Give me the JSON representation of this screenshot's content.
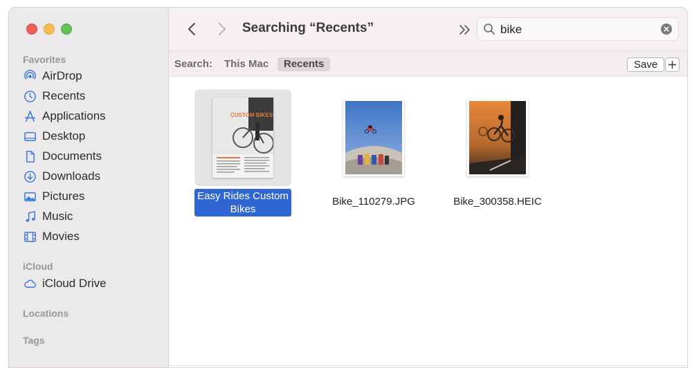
{
  "window": {
    "title": "Searching “Recents”"
  },
  "sidebar": {
    "sections": {
      "favorites": "Favorites",
      "icloud": "iCloud",
      "locations": "Locations",
      "tags": "Tags"
    },
    "favorites": [
      {
        "label": "AirDrop",
        "icon": "airdrop-icon"
      },
      {
        "label": "Recents",
        "icon": "clock-icon"
      },
      {
        "label": "Applications",
        "icon": "applications-icon"
      },
      {
        "label": "Desktop",
        "icon": "desktop-icon"
      },
      {
        "label": "Documents",
        "icon": "document-icon"
      },
      {
        "label": "Downloads",
        "icon": "download-icon"
      },
      {
        "label": "Pictures",
        "icon": "pictures-icon"
      },
      {
        "label": "Music",
        "icon": "music-note-icon"
      },
      {
        "label": "Movies",
        "icon": "film-icon"
      }
    ],
    "icloud_items": [
      {
        "label": "iCloud Drive",
        "icon": "cloud-icon"
      }
    ]
  },
  "search": {
    "value": "bike",
    "placeholder": "Search"
  },
  "scope": {
    "label": "Search:",
    "options": [
      "This Mac",
      "Recents"
    ],
    "selected": "Recents",
    "save_label": "Save"
  },
  "files": [
    {
      "name": "Easy Rides Custom Bikes",
      "selected": true,
      "kind": "document-thumbnail"
    },
    {
      "name": "Bike_110279.JPG",
      "selected": false,
      "kind": "photo-thumbnail"
    },
    {
      "name": "Bike_300358.HEIC",
      "selected": false,
      "kind": "photo-thumbnail"
    }
  ],
  "thumb_text": {
    "doc_heading": "CUSTOM BIKES"
  },
  "colors": {
    "selection": "#2f66d4",
    "sidebar_bg": "#ece9ea",
    "toolbar_bg": "#f6f0f0",
    "close": "#ed5f57",
    "minimize": "#f5bd4f",
    "zoom": "#5fc454"
  }
}
